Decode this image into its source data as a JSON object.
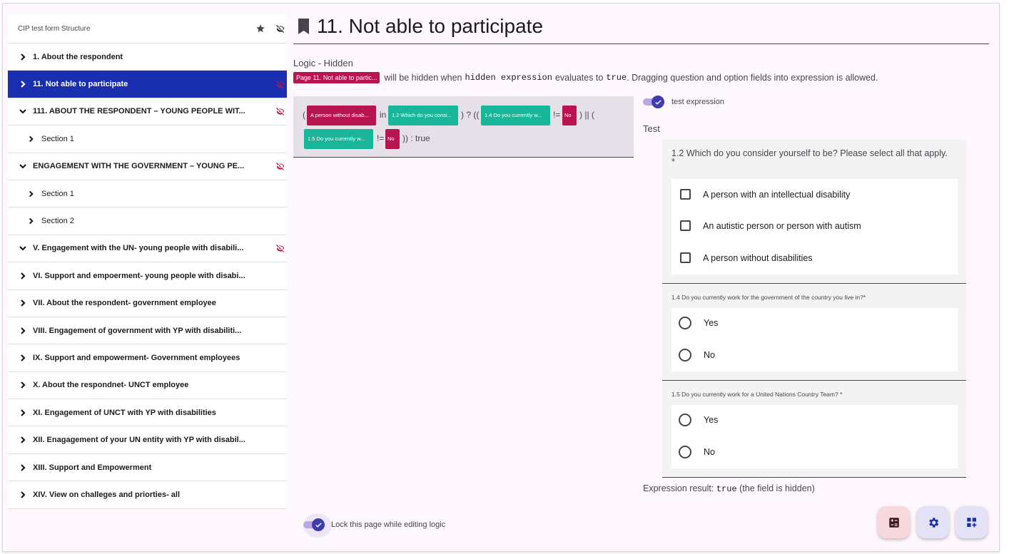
{
  "sidebar": {
    "title": "CIP test form Structure",
    "items": [
      {
        "label": "1. About the respondent",
        "level": 0,
        "expanded": false,
        "active": false,
        "hidden": false
      },
      {
        "label": "11. Not able to participate",
        "level": 0,
        "expanded": false,
        "active": true,
        "hidden": true
      },
      {
        "label": "111. ABOUT THE RESPONDENT – YOUNG PEOPLE WIT...",
        "level": 0,
        "expanded": true,
        "active": false,
        "hidden": true
      },
      {
        "label": "Section 1",
        "level": 1,
        "expanded": false,
        "active": false,
        "hidden": false
      },
      {
        "label": "ENGAGEMENT WITH THE GOVERNMENT – YOUNG PE...",
        "level": 0,
        "expanded": true,
        "active": false,
        "hidden": true
      },
      {
        "label": "Section 1",
        "level": 1,
        "expanded": false,
        "active": false,
        "hidden": false
      },
      {
        "label": "Section 2",
        "level": 1,
        "expanded": false,
        "active": false,
        "hidden": false
      },
      {
        "label": "V. Engagement with the UN- young people with disabili...",
        "level": 0,
        "expanded": true,
        "active": false,
        "hidden": true
      },
      {
        "label": "VI. Support and empoerment- young people with disabi...",
        "level": 0,
        "expanded": false,
        "active": false,
        "hidden": false
      },
      {
        "label": "VII. About the respondent- government employee",
        "level": 0,
        "expanded": false,
        "active": false,
        "hidden": false
      },
      {
        "label": "VIII. Engagement of government with YP with disabiliti...",
        "level": 0,
        "expanded": false,
        "active": false,
        "hidden": false
      },
      {
        "label": "IX. Support and empowerment- Government employees",
        "level": 0,
        "expanded": false,
        "active": false,
        "hidden": false
      },
      {
        "label": "X. About the respondnet- UNCT employee",
        "level": 0,
        "expanded": false,
        "active": false,
        "hidden": false
      },
      {
        "label": "XI. Engagement of UNCT with YP with disabilities",
        "level": 0,
        "expanded": false,
        "active": false,
        "hidden": false
      },
      {
        "label": "XII. Enagagement of your UN entity with YP with disabil...",
        "level": 0,
        "expanded": false,
        "active": false,
        "hidden": false
      },
      {
        "label": "XIII. Support and Empowerment",
        "level": 0,
        "expanded": false,
        "active": false,
        "hidden": false
      },
      {
        "label": "XIV. View on challeges and priorties- all",
        "level": 0,
        "expanded": false,
        "active": false,
        "hidden": false
      }
    ]
  },
  "page": {
    "title": "11. Not able to participate"
  },
  "logic": {
    "label": "Logic - Hidden",
    "page_chip": "Page 11. Not able to partic...",
    "desc_1": "will be hidden when",
    "desc_code_1": "hidden expression",
    "desc_2": "evaluates to",
    "desc_code_2": "true",
    "desc_3": ". Dragging question and option fields into expression is allowed."
  },
  "expression": {
    "open_paren_1": "(",
    "chip_1": "A person without disab...",
    "in": "in",
    "chip_2": "1.2 Which do you consi...",
    "mid_1": ") ? ((",
    "chip_3": "1.4 Do you currently w...",
    "neq_1": "!=",
    "chip_4": "No",
    "mid_2": ") || (",
    "chip_5": "1.5 Do you currently w...",
    "neq_2": "!=",
    "chip_6": "No",
    "end": ")) : true"
  },
  "test": {
    "toggle_label": "test expression",
    "label": "Test",
    "q1": {
      "title": "1.2 Which do you consider yourself to be? Please select all that apply.",
      "required": "*",
      "options": [
        "A person with an intellectual disability",
        "An autistic person or person with autism",
        "A person without disabilities"
      ]
    },
    "q2": {
      "title": "1.4 Do you currently work for the government of the country you live in?*",
      "options": [
        "Yes",
        "No"
      ]
    },
    "q3": {
      "title": "1.5 Do you currently work for a United Nations Country Team? *",
      "options": [
        "Yes",
        "No"
      ]
    },
    "result_label": "Expression result:",
    "result_value": "true",
    "result_note": "(the field is hidden)"
  },
  "footer": {
    "lock_label": "Lock this page while editing logic"
  },
  "colors": {
    "accent": "#1a2fb0",
    "chip_red": "#b8144f",
    "chip_teal": "#1ab69a"
  },
  "icons": {
    "star": "star-icon",
    "eye_off": "eye-off-icon",
    "bookmark": "bookmark-icon",
    "calculator": "calculator-icon",
    "gear": "gear-icon",
    "add_widget": "add-widget-icon"
  }
}
